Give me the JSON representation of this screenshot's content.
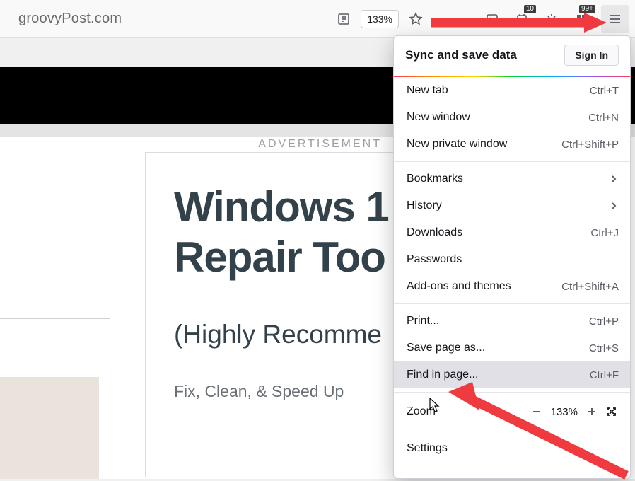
{
  "toolbar": {
    "url": "groovyPost.com",
    "zoom_badge": "133%",
    "ext_badge1": "10",
    "ext_badge2": "99+"
  },
  "page": {
    "ad_label": "ADVERTISEMENT",
    "article_title_l1": "Windows 1",
    "article_title_l2": "Repair Too",
    "article_sub": "(Highly Recomme",
    "article_body": "Fix, Clean, & Speed Up"
  },
  "menu": {
    "header_title": "Sync and save data",
    "signin": "Sign In",
    "items": {
      "new_tab": {
        "label": "New tab",
        "shortcut": "Ctrl+T"
      },
      "new_window": {
        "label": "New window",
        "shortcut": "Ctrl+N"
      },
      "new_private": {
        "label": "New private window",
        "shortcut": "Ctrl+Shift+P"
      },
      "bookmarks": {
        "label": "Bookmarks"
      },
      "history": {
        "label": "History"
      },
      "downloads": {
        "label": "Downloads",
        "shortcut": "Ctrl+J"
      },
      "passwords": {
        "label": "Passwords"
      },
      "addons": {
        "label": "Add-ons and themes",
        "shortcut": "Ctrl+Shift+A"
      },
      "print": {
        "label": "Print...",
        "shortcut": "Ctrl+P"
      },
      "save_as": {
        "label": "Save page as...",
        "shortcut": "Ctrl+S"
      },
      "find": {
        "label": "Find in page...",
        "shortcut": "Ctrl+F"
      },
      "zoom": {
        "label": "Zoom",
        "pct": "133%"
      },
      "settings": {
        "label": "Settings"
      }
    }
  }
}
